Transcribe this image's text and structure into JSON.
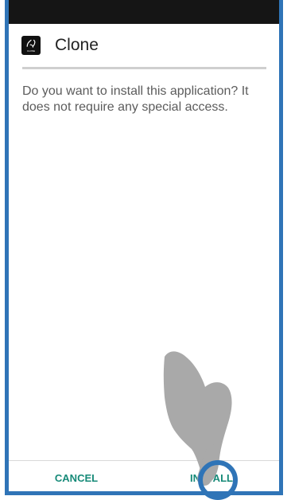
{
  "app": {
    "title": "Clone",
    "icon_label": "CLONE"
  },
  "dialog": {
    "message": "Do you want to install this application? It does not require any special access."
  },
  "buttons": {
    "cancel": "CANCEL",
    "install": "INSTALL"
  },
  "colors": {
    "frame": "#2f74b7",
    "accent": "#168a78",
    "status_bar": "#151515",
    "tap_ring": "#2f74b7",
    "hand": "#a9a9a9"
  },
  "icons": {
    "app": "clone-app-icon",
    "overlay": "pointing-hand-icon"
  }
}
